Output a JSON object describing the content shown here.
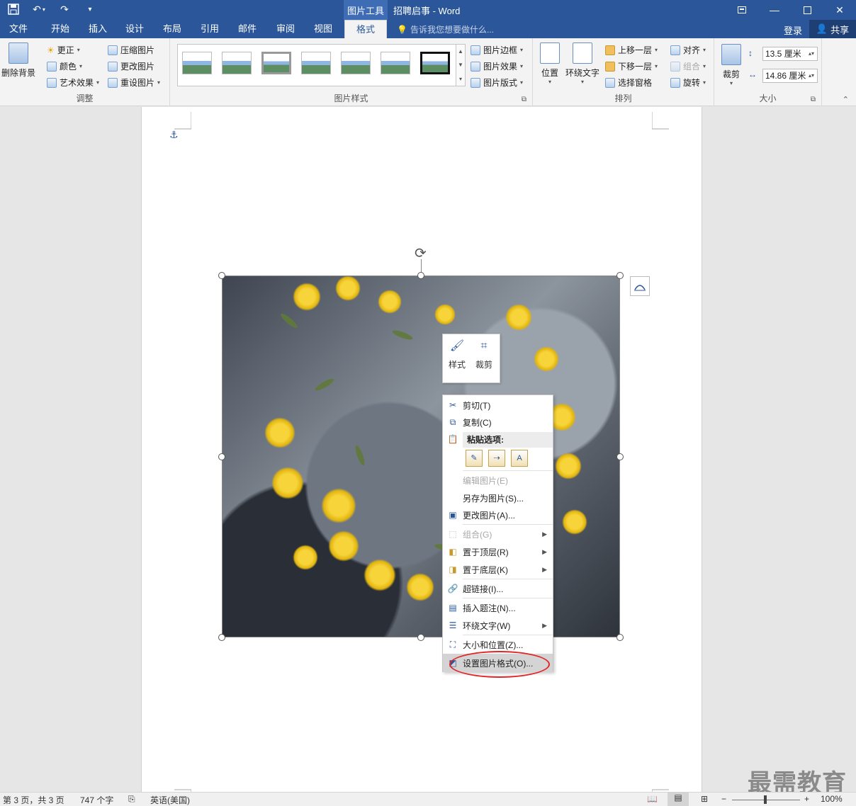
{
  "window": {
    "context_tab": "图片工具",
    "title": "招聘启事 - Word",
    "controls": [
      "restore-ribbon",
      "minimize",
      "maximize",
      "close"
    ]
  },
  "qat": {
    "save": "save-icon",
    "undo": "undo-icon",
    "redo": "redo-icon",
    "customize": "▾"
  },
  "tabs": [
    "文件",
    "开始",
    "插入",
    "设计",
    "布局",
    "引用",
    "邮件",
    "审阅",
    "视图",
    "格式"
  ],
  "active_tab": "格式",
  "tellme": "告诉我您想要做什么...",
  "account": {
    "login": "登录",
    "share": "共享"
  },
  "ribbon": {
    "adjust": {
      "label": "调整",
      "remove_bg": "删除背景",
      "corrections": "更正",
      "color": "颜色",
      "artistic": "艺术效果",
      "compress": "压缩图片",
      "change": "更改图片",
      "reset": "重设图片"
    },
    "styles": {
      "label": "图片样式",
      "border": "图片边框",
      "effects": "图片效果",
      "layout": "图片版式"
    },
    "arrange": {
      "label": "排列",
      "position": "位置",
      "wrap": "环绕文字",
      "forward": "上移一层",
      "backward": "下移一层",
      "selection_pane": "选择窗格",
      "align": "对齐",
      "group": "组合",
      "rotate": "旋转"
    },
    "size": {
      "label": "大小",
      "crop": "裁剪",
      "height": "13.5 厘米",
      "width": "14.86 厘米"
    }
  },
  "minibar": {
    "style": "样式",
    "crop": "裁剪"
  },
  "context_menu": {
    "cut": "剪切(T)",
    "copy": "复制(C)",
    "paste_options": "粘贴选项:",
    "edit_picture": "编辑图片(E)",
    "save_as_picture": "另存为图片(S)...",
    "change_picture": "更改图片(A)...",
    "group": "组合(G)",
    "bring_front": "置于顶层(R)",
    "send_back": "置于底层(K)",
    "hyperlink": "超链接(I)...",
    "insert_caption": "插入题注(N)...",
    "wrap_text": "环绕文字(W)",
    "size_position": "大小和位置(Z)...",
    "format_picture": "设置图片格式(O)..."
  },
  "status": {
    "page": "第 3 页，共 3 页",
    "words": "747 个字",
    "language": "英语(美国)",
    "zoom": "100%"
  },
  "watermark": "最需教育"
}
